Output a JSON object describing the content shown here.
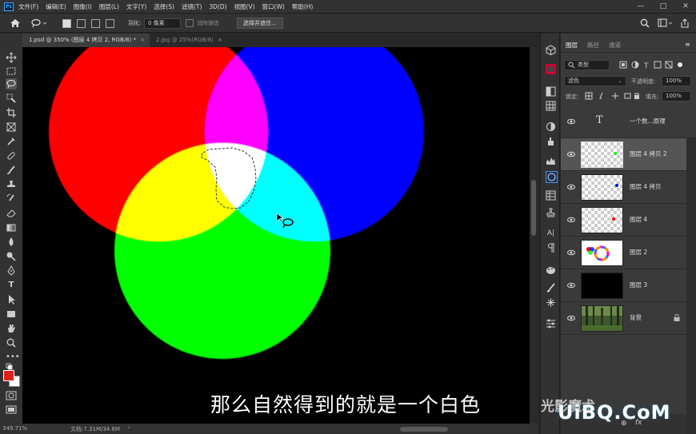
{
  "menubar": {
    "logo": "Ps",
    "items": [
      "文件(F)",
      "编辑(E)",
      "图像(I)",
      "图层(L)",
      "文字(Y)",
      "选择(S)",
      "滤镜(T)",
      "3D(D)",
      "视图(V)",
      "窗口(W)",
      "帮助(H)"
    ],
    "minimize": "—",
    "maximize": "□",
    "close": "✕"
  },
  "options": {
    "feather_label": "羽化:",
    "feather_value": "0 像素",
    "antialias_label": "消除锯齿",
    "select_mask_button": "选择并遮住..."
  },
  "tabs": [
    {
      "label": "1.psd @ 350% (图层 4 拷贝 2, RGB/8) *",
      "close": "×"
    },
    {
      "label": "2.jpg @ 25%(RGB/8)",
      "close": "×"
    }
  ],
  "canvas": {
    "caption": "那么自然得到的就是一个白色",
    "colors": {
      "red": "#ff0000",
      "green": "#00ff00",
      "blue": "#0000ff",
      "yellow": "#ffff00",
      "cyan": "#00ffff",
      "magenta": "#ff00ff",
      "white": "#ffffff",
      "background": "#000000"
    }
  },
  "status": {
    "zoom": "349.71%",
    "doc": "文档:7.31M/34.6M",
    "arrow": "›"
  },
  "panel": {
    "tabs": [
      "图层",
      "路径",
      "通道"
    ],
    "filter_kind": "类型",
    "blend_mode": "滤色",
    "opacity_label": "不透明度:",
    "opacity_value": "100%",
    "lock_label": "锁定:",
    "fill_label": "填充:",
    "fill_value": "100%",
    "layers": [
      {
        "name": "一个数...原理",
        "kind": "text",
        "thumb": "T"
      },
      {
        "name": "图层 4 拷贝 2",
        "kind": "dot",
        "dot_color": "#00ff00",
        "selected": true
      },
      {
        "name": "图层 4 拷贝",
        "kind": "dot",
        "dot_color": "#0000ff"
      },
      {
        "name": "图层 4",
        "kind": "dot",
        "dot_color": "#ff0000"
      },
      {
        "name": "图层 2",
        "kind": "wheel"
      },
      {
        "name": "图层 3",
        "kind": "black"
      },
      {
        "name": "背景",
        "kind": "photo",
        "locked": true
      }
    ],
    "footer": {
      "link": "⊕",
      "fx": "fx"
    }
  },
  "watermark": {
    "left": "光影魔术",
    "site": "UiBQ.CoM"
  }
}
